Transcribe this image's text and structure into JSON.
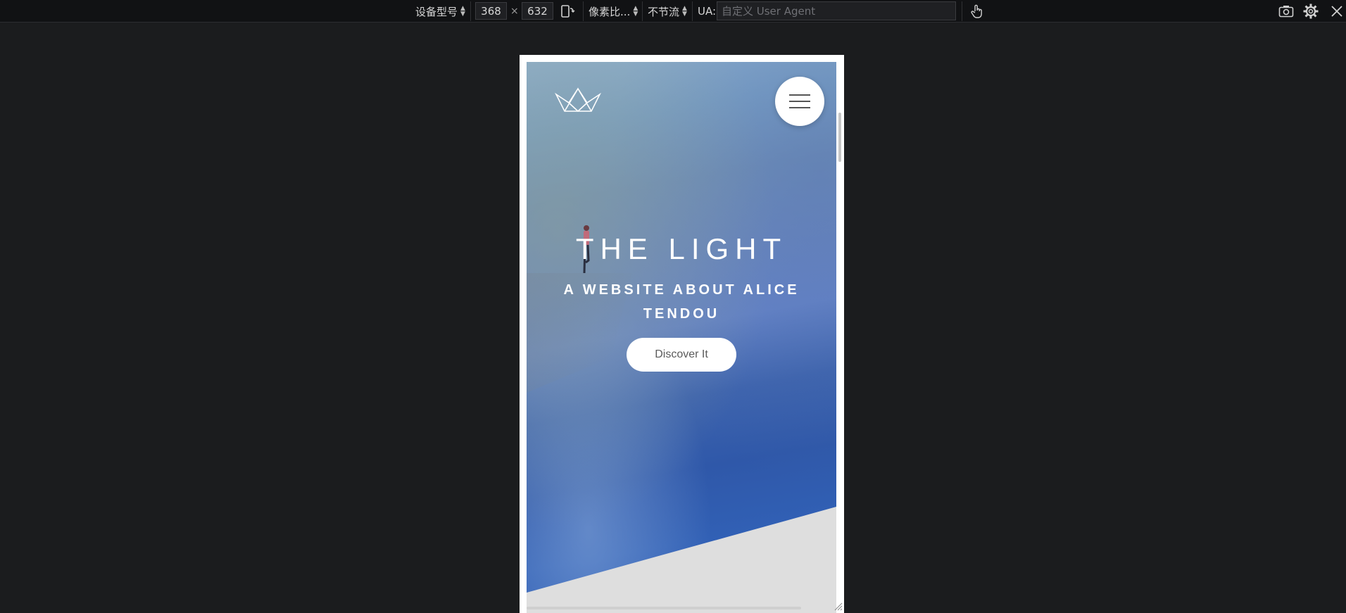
{
  "toolbar": {
    "device_label": "设备型号",
    "width": "368",
    "times": "×",
    "height": "632",
    "pixel_ratio_label": "像素比...",
    "throttle_label": "不节流",
    "ua_label": "UA:",
    "ua_placeholder": "自定义 User Agent",
    "icons": [
      "rotate-icon",
      "touch-icon",
      "screenshot-icon",
      "settings-icon",
      "close-icon"
    ]
  },
  "site": {
    "title": "THE LIGHT",
    "subtitle": "A WEBSITE ABOUT ALICE TENDOU",
    "cta_label": "Discover It",
    "icons": [
      "crown-logo-icon",
      "hamburger-menu-icon"
    ]
  },
  "colors": {
    "toolbar_bg": "#111214",
    "page_bg": "#1b1c1e",
    "hero_blue": "#2f58a9",
    "footer_grey": "#dedede",
    "accent_white": "#ffffff"
  }
}
